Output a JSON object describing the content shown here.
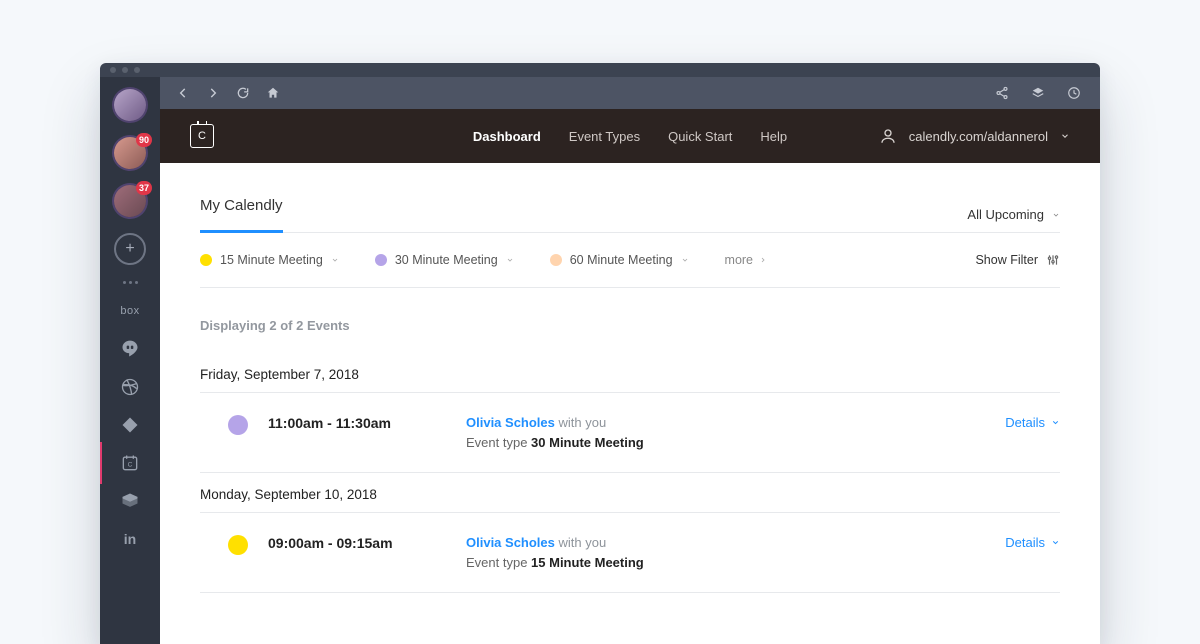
{
  "sidebar": {
    "avatars": [
      {
        "badge": null
      },
      {
        "badge": "90"
      },
      {
        "badge": "37"
      }
    ],
    "apps": [
      {
        "name": "box",
        "label": "box"
      },
      {
        "name": "hangouts"
      },
      {
        "name": "dribbble"
      },
      {
        "name": "jira"
      },
      {
        "name": "calendly"
      },
      {
        "name": "box2"
      },
      {
        "name": "linkedin",
        "label": "in"
      }
    ]
  },
  "nav": {
    "links": [
      "Dashboard",
      "Event Types",
      "Quick Start",
      "Help"
    ],
    "active": 0,
    "user_url": "calendly.com/aldannerol"
  },
  "tabs": {
    "active": "My Calendly",
    "dropdown": "All Upcoming"
  },
  "meeting_types": [
    {
      "label": "15 Minute Meeting",
      "color": "yellow"
    },
    {
      "label": "30 Minute Meeting",
      "color": "purple"
    },
    {
      "label": "60 Minute Meeting",
      "color": "peach"
    }
  ],
  "more_label": "more",
  "filter_label": "Show Filter",
  "displaying": {
    "prefix": "Displaying ",
    "shown": "2",
    "mid": " of ",
    "total": "2",
    "suffix": " Events"
  },
  "groups": [
    {
      "date": "Friday, September 7, 2018",
      "events": [
        {
          "color": "purple",
          "time": "11:00am - 11:30am",
          "person": "Olivia Scholes",
          "with": "with you",
          "type_label": "Event type ",
          "type": "30 Minute Meeting",
          "details": "Details"
        }
      ]
    },
    {
      "date": "Monday, September 10, 2018",
      "events": [
        {
          "color": "yellow",
          "time": "09:00am - 09:15am",
          "person": "Olivia Scholes",
          "with": "with you",
          "type_label": "Event type ",
          "type": "15 Minute Meeting",
          "details": "Details"
        }
      ]
    }
  ]
}
